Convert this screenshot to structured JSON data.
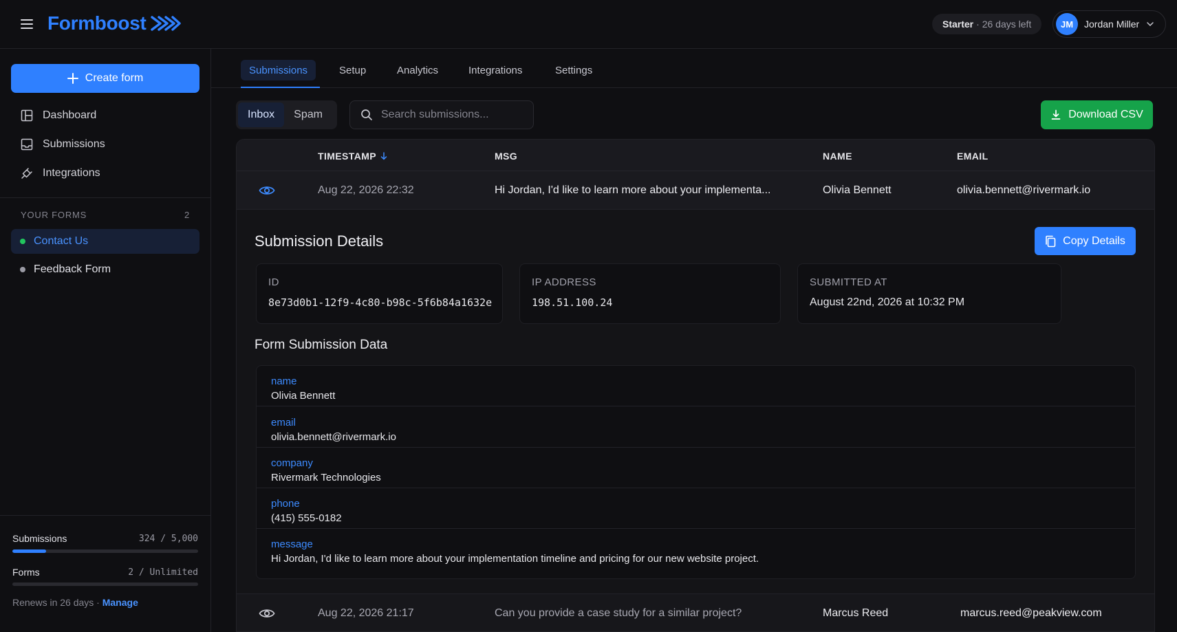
{
  "header": {
    "logo_text": "Formboost",
    "plan_name": "Starter",
    "plan_days": "· 26 days left",
    "user_initials": "JM",
    "user_name": "Jordan Miller"
  },
  "sidebar": {
    "create_label": "Create form",
    "nav": [
      {
        "label": "Dashboard",
        "icon": "layout-icon"
      },
      {
        "label": "Submissions",
        "icon": "inbox-icon"
      },
      {
        "label": "Integrations",
        "icon": "plug-icon"
      }
    ],
    "forms_heading": "YOUR FORMS",
    "forms_count": "2",
    "forms": [
      {
        "label": "Contact Us",
        "active": true,
        "dot_color": "#22c55e"
      },
      {
        "label": "Feedback Form",
        "active": false,
        "dot_color": "#9a9aa4"
      }
    ],
    "usage": {
      "submissions_label": "Submissions",
      "submissions_value": "324 / 5,000",
      "submissions_fraction": 0.0648,
      "forms_label": "Forms",
      "forms_value": "2 / Unlimited",
      "forms_fraction": 0,
      "renew_text": "Renews in 26 days ·",
      "manage_label": "Manage"
    }
  },
  "tabs": [
    "Submissions",
    "Setup",
    "Analytics",
    "Integrations",
    "Settings"
  ],
  "toolbar": {
    "inbox_label": "Inbox",
    "spam_label": "Spam",
    "search_placeholder": "Search submissions...",
    "download_label": "Download CSV"
  },
  "table": {
    "headers": {
      "timestamp": "TIMESTAMP",
      "msg": "MSG",
      "name": "NAME",
      "email": "EMAIL"
    },
    "rows": [
      {
        "timestamp": "Aug 22, 2026 22:32",
        "msg": "Hi Jordan, I'd like to learn more about your implementa...",
        "name": "Olivia Bennett",
        "email": "olivia.bennett@rivermark.io"
      },
      {
        "timestamp": "Aug 22, 2026 21:17",
        "msg": "Can you provide a case study for a similar project?",
        "name": "Marcus Reed",
        "email": "marcus.reed@peakview.com"
      }
    ]
  },
  "details": {
    "title": "Submission Details",
    "copy_label": "Copy Details",
    "id_label": "ID",
    "id_value": "8e73d0b1-12f9-4c80-b98c-5f6b84a1632e",
    "ip_label": "IP ADDRESS",
    "ip_value": "198.51.100.24",
    "submitted_label": "SUBMITTED AT",
    "submitted_value": "August 22nd, 2026 at 10:32 PM",
    "data_title": "Form Submission Data",
    "fields": [
      {
        "key": "name",
        "value": "Olivia Bennett"
      },
      {
        "key": "email",
        "value": "olivia.bennett@rivermark.io"
      },
      {
        "key": "company",
        "value": "Rivermark Technologies"
      },
      {
        "key": "phone",
        "value": "(415) 555-0182"
      },
      {
        "key": "message",
        "value": "Hi Jordan, I'd like to learn more about your implementation timeline and pricing for our new website project."
      }
    ]
  },
  "colors": {
    "accent": "#2f80ff",
    "success": "#16a34a",
    "background": "#0f0f12"
  }
}
